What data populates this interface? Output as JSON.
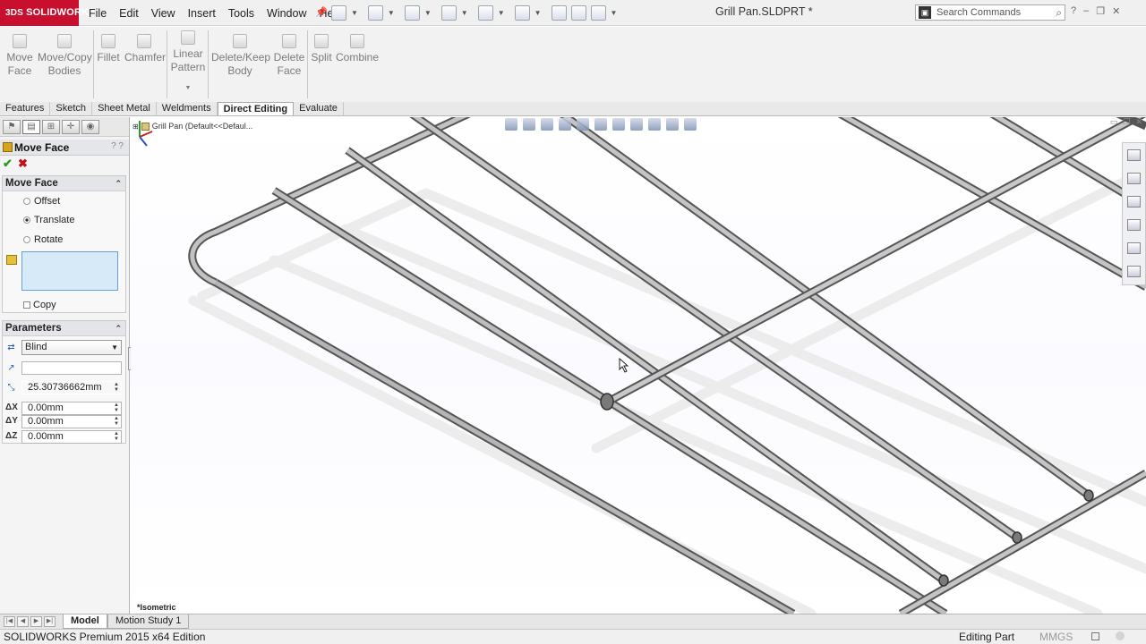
{
  "app": {
    "brand": "SOLIDWORKS",
    "document_title": "Grill Pan.SLDPRT *",
    "search_placeholder": "Search Commands",
    "menu": [
      "File",
      "Edit",
      "View",
      "Insert",
      "Tools",
      "Window",
      "Help"
    ]
  },
  "ribbon": {
    "buttons": [
      {
        "label": "Move\nFace",
        "icon": "move-face-icon"
      },
      {
        "label": "Move/Copy\nBodies",
        "icon": "move-copy-bodies-icon"
      },
      {
        "label": "Fillet",
        "icon": "fillet-icon"
      },
      {
        "label": "Chamfer",
        "icon": "chamfer-icon"
      },
      {
        "label": "Linear\nPattern",
        "icon": "linear-pattern-icon"
      },
      {
        "label": "Delete/Keep\nBody",
        "icon": "delete-keep-body-icon"
      },
      {
        "label": "Delete\nFace",
        "icon": "delete-face-icon"
      },
      {
        "label": "Split",
        "icon": "split-icon"
      },
      {
        "label": "Combine",
        "icon": "combine-icon"
      }
    ],
    "tabs": [
      "Features",
      "Sketch",
      "Sheet Metal",
      "Weldments",
      "Direct Editing",
      "Evaluate"
    ],
    "active_tab": "Direct Editing"
  },
  "property_manager": {
    "title": "Move Face",
    "help_glyphs": "? ?",
    "ok_glyph": "✔",
    "cancel_glyph": "✖",
    "move_face_group": {
      "header": "Move Face",
      "options": [
        "Offset",
        "Translate",
        "Rotate"
      ],
      "selected": "Translate",
      "copy_label": "Copy"
    },
    "parameters_group": {
      "header": "Parameters",
      "end_condition": "Blind",
      "direction_value": "",
      "distance": "25.30736662mm",
      "dx_label": "ΔX",
      "dy_label": "ΔY",
      "dz_label": "ΔZ",
      "dx": "0.00mm",
      "dy": "0.00mm",
      "dz": "0.00mm"
    }
  },
  "viewport": {
    "feature_tree_root": "Grill Pan  (Default<<Defaul...",
    "view_orientation": "*Isometric"
  },
  "bottom_tabs": [
    "Model",
    "Motion Study 1"
  ],
  "active_bottom_tab": "Model",
  "status_bar": {
    "edition": "SOLIDWORKS Premium 2015 x64 Edition",
    "mode": "Editing Part",
    "units": "MMGS"
  },
  "colors": {
    "brand_red": "#c8102e",
    "rod_mid": "#8c8c8c",
    "rod_dark": "#4a4a4a",
    "selection_blue": "#d6eaf8"
  }
}
